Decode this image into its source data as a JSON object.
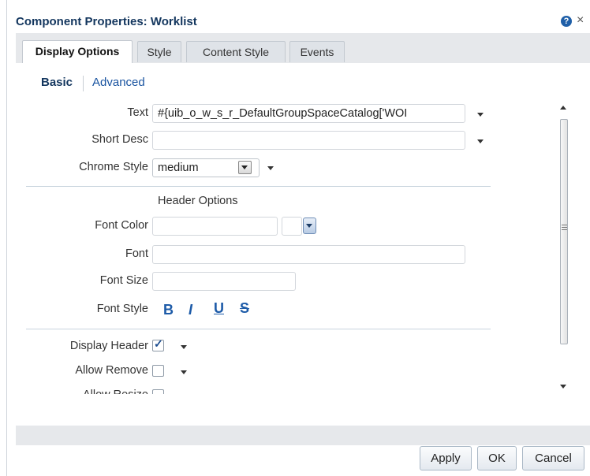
{
  "dialog": {
    "title": "Component Properties: Worklist"
  },
  "icons": {
    "help": "help-icon",
    "close": "close-icon"
  },
  "tabs": [
    {
      "label": "Display Options",
      "active": true
    },
    {
      "label": "Style",
      "active": false
    },
    {
      "label": "Content Style",
      "active": false
    },
    {
      "label": "Events",
      "active": false
    }
  ],
  "subtabs": {
    "basic": "Basic",
    "advanced": "Advanced",
    "selected": "Basic"
  },
  "fields": {
    "text": {
      "label": "Text",
      "value": "#{uib_o_w_s_r_DefaultGroupSpaceCatalog['WOI"
    },
    "short_desc": {
      "label": "Short Desc",
      "value": ""
    },
    "chrome_style": {
      "label": "Chrome Style",
      "value": "medium"
    }
  },
  "header_options": {
    "heading": "Header Options",
    "font_color_label": "Font Color",
    "font_color_value": "",
    "font_label": "Font",
    "font_value": "",
    "font_size_label": "Font Size",
    "font_size_value": "",
    "font_style_label": "Font Style",
    "font_style_buttons": {
      "bold": "B",
      "italic": "I",
      "underline": "U",
      "strike": "S"
    }
  },
  "checkboxes": [
    {
      "label": "Display Header",
      "checked": true
    },
    {
      "label": "Allow Remove",
      "checked": false
    },
    {
      "label": "Allow Resize",
      "checked": false
    }
  ],
  "footer": {
    "apply": "Apply",
    "ok": "OK",
    "cancel": "Cancel"
  },
  "colors": {
    "title": "#13365e",
    "accent": "#1d5ba8",
    "tabbar": "#e6e8eb"
  }
}
